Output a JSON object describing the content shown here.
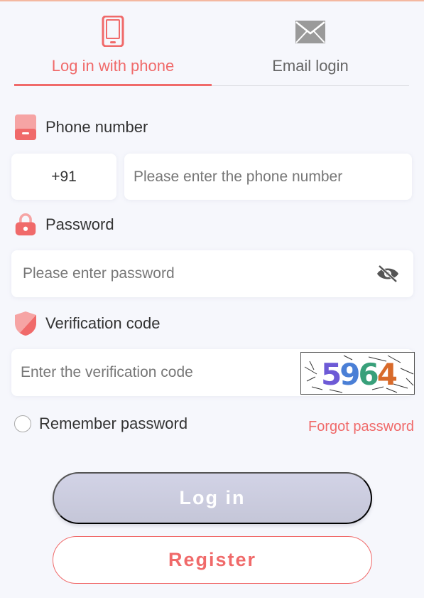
{
  "tabs": [
    {
      "label": "Log in with phone",
      "icon": "phone-icon",
      "active": true
    },
    {
      "label": "Email login",
      "icon": "envelope-icon",
      "active": false
    }
  ],
  "phone": {
    "label": "Phone number",
    "country_code": "+91",
    "placeholder": "Please enter the phone number"
  },
  "password": {
    "label": "Password",
    "placeholder": "Please enter password"
  },
  "verification": {
    "label": "Verification code",
    "placeholder": "Enter the verification code",
    "captcha_digits": [
      "5",
      "9",
      "6",
      "4"
    ],
    "captcha_colors": [
      "#6d5ad6",
      "#4a7fd6",
      "#38a07a",
      "#d86a2a"
    ]
  },
  "remember": {
    "label": "Remember password",
    "checked": false
  },
  "forgot_label": "Forgot password",
  "login_label": "Log in",
  "register_label": "Register",
  "colors": {
    "accent": "#f06a6a",
    "background": "#f6f7fc",
    "login_button": "#c9cadc"
  }
}
